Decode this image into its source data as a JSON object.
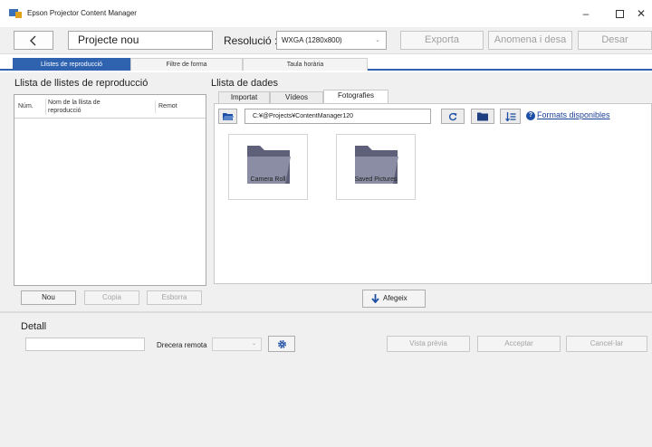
{
  "window": {
    "title": "Epson Projector Content Manager",
    "minimize_glyph": "–",
    "close_glyph": "✕"
  },
  "toolbar": {
    "project_name": "Projecte nou",
    "resolution_label": "Resolució :",
    "resolution_value": "WXGA (1280x800)",
    "export_label": "Exporta",
    "save_as_label": "Anomena i desa",
    "save_label": "Desar"
  },
  "tabs": [
    {
      "label": "Llistes de reproducció",
      "active": true
    },
    {
      "label": "Filtre de forma",
      "active": false
    },
    {
      "label": "Taula horària",
      "active": false
    }
  ],
  "playlists": {
    "heading": "Llista de llistes de reproducció",
    "columns": [
      "Núm.",
      "Nom de la llista de reproducció",
      "Remot"
    ],
    "new_label": "Nou",
    "copy_label": "Copia",
    "delete_label": "Esborra"
  },
  "data_list": {
    "heading": "Llista de dades",
    "subtabs": [
      {
        "label": "Importat",
        "active": false
      },
      {
        "label": "Vídeos",
        "active": false
      },
      {
        "label": "Fotografies",
        "active": true
      }
    ],
    "path": "C:¥@Projects¥ContentManager120",
    "formats_link": "Formats disponibles",
    "help_glyph": "?",
    "items": [
      {
        "label": "Camera Roll",
        "icon": "folder-icon"
      },
      {
        "label": "Saved Pictures",
        "icon": "folder-icon"
      }
    ],
    "add_label": "Afegeix"
  },
  "detail": {
    "heading": "Detall",
    "remote_label": "Drecera remota",
    "preview_label": "Vista prèvia",
    "accept_label": "Acceptar",
    "cancel_label": "Cancel·lar"
  },
  "colors": {
    "accent": "#2f63b0",
    "link": "#1a3f99",
    "folder": "#7c7f93"
  }
}
